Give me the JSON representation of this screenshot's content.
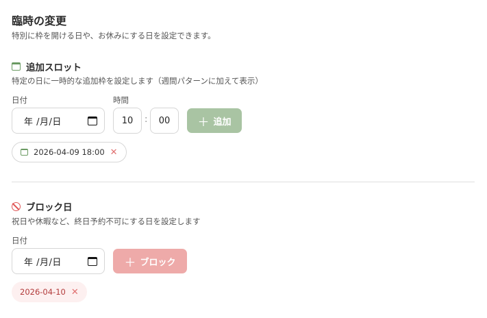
{
  "header": {
    "title": "臨時の変更",
    "subtitle": "特別に枠を開ける日や、お休みにする日を設定できます。"
  },
  "extra_slot": {
    "icon": "calendar-icon",
    "title": "追加スロット",
    "description": "特定の日に一時的な追加枠を設定します（週間パターンに加えて表示）",
    "date_label": "日付",
    "date_value": "年 /月/日",
    "time_label": "時間",
    "hour": "10",
    "minute": "00",
    "colon": ":",
    "add_button": "追加",
    "plus": "＋",
    "chips": [
      {
        "label": "2026-04-09 18:00",
        "remove": "✕"
      }
    ]
  },
  "block_day": {
    "icon": "ban-icon",
    "title": "ブロック日",
    "description": "祝日や休暇など、終日予約不可にする日を設定します",
    "date_label": "日付",
    "date_value": "年 /月/日",
    "block_button": "ブロック",
    "plus": "＋",
    "chips": [
      {
        "label": "2026-04-10",
        "remove": "✕"
      }
    ]
  },
  "colors": {
    "accent_green": "#a9c4a3",
    "accent_red": "#eeaaa9",
    "icon_green": "#6a9a62",
    "icon_red": "#e05555"
  }
}
